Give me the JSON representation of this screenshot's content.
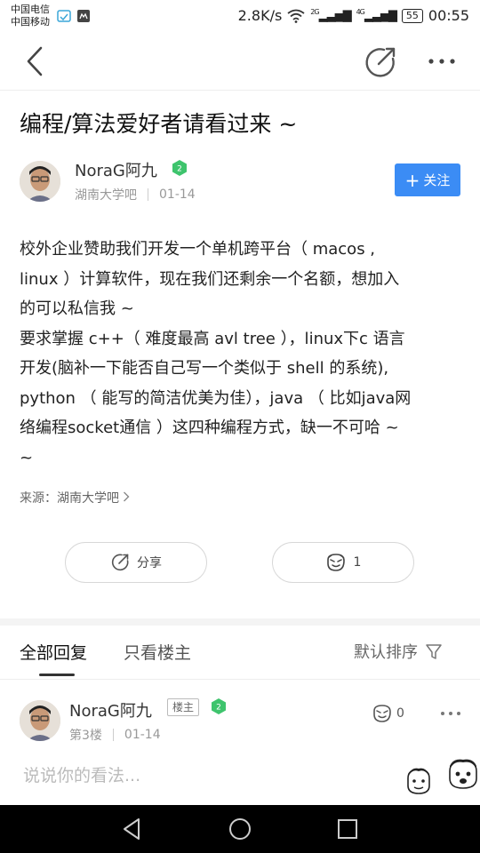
{
  "status_bar": {
    "carrier_1": "中国电信",
    "carrier_2": "中国移动",
    "net_speed": "2.8K/s",
    "sim1_net": "2G",
    "sim2_net": "4G",
    "battery": "55",
    "time": "00:55"
  },
  "post": {
    "title": "编程/算法爱好者请看过来 ~",
    "author": {
      "name": "NoraG阿九",
      "level": "2",
      "forum": "湖南大学吧",
      "date": "01-14"
    },
    "follow_label": "关注",
    "body_lines": [
      "校外企业赞助我们开发一个单机跨平台（ macos ,",
      "linux ）计算软件，现在我们还剩余一个名额，想加入",
      "的可以私信我 ~",
      "要求掌握 c++（ 难度最高 avl tree ），linux下c 语言",
      "开发(脑补一下能否自己写一个类似于 shell 的系统),",
      "python （ 能写的简洁优美为佳），java （ 比如java网",
      "络编程socket通信 ）这四种编程方式，缺一不可哈 ~",
      "~"
    ],
    "source_label": "来源：",
    "source_name": "湖南大学吧",
    "share_label": "分享",
    "like_count": "1"
  },
  "replies_section": {
    "tab_all": "全部回复",
    "tab_owner_only": "只看楼主",
    "sort_label": "默认排序"
  },
  "reply": {
    "name": "NoraG阿九",
    "owner_tag": "楼主",
    "level": "2",
    "floor": "第3楼",
    "date": "01-14",
    "like_count": "0"
  },
  "comment_placeholder": "说说你的看法...",
  "colors": {
    "accent": "#3b8cf5",
    "level_badge": "#3ec46d"
  }
}
